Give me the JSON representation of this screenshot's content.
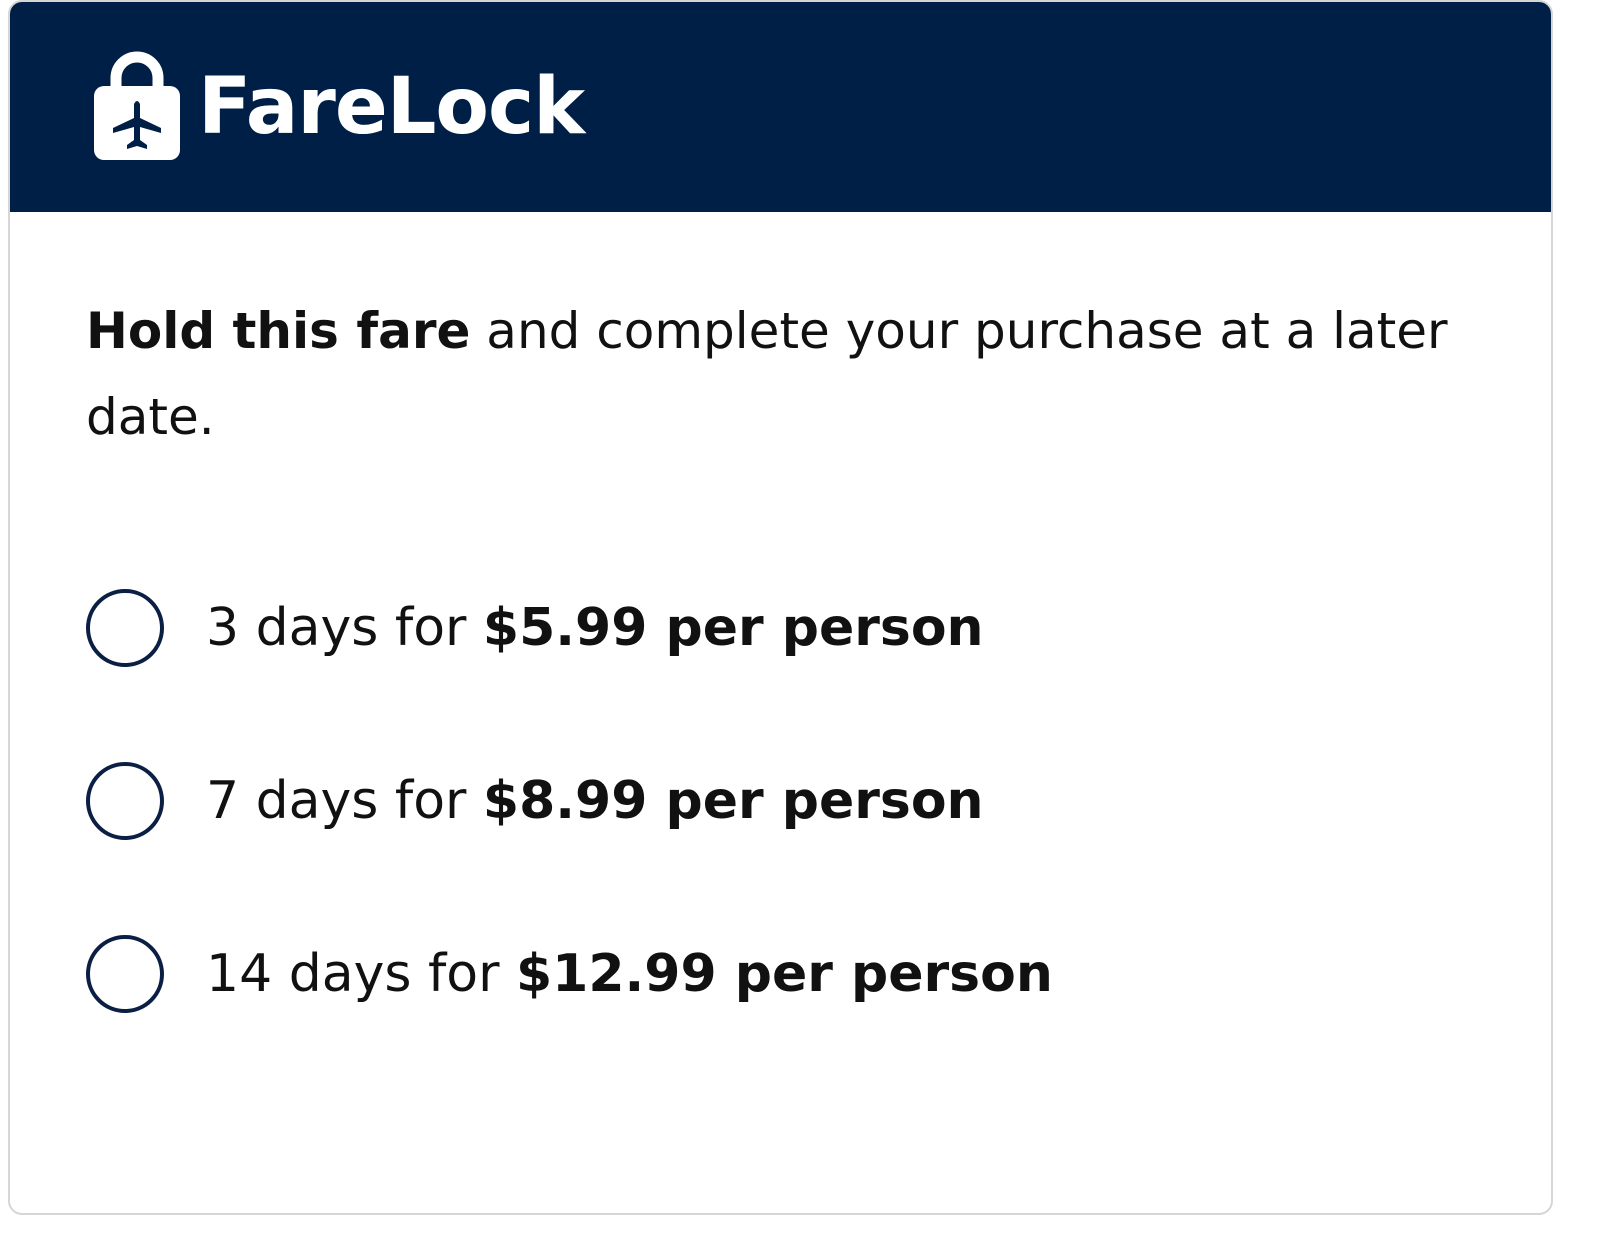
{
  "header": {
    "title": "FareLock",
    "icon": "lock-plane-icon",
    "background_color": "#001f47"
  },
  "description": {
    "bold": "Hold this fare",
    "rest": " and complete your purchase at a later date."
  },
  "options": [
    {
      "prefix": "3 days for ",
      "price": "$5.99 per person",
      "selected": false
    },
    {
      "prefix": "7 days for ",
      "price": "$8.99 per person",
      "selected": false
    },
    {
      "prefix": "14 days for ",
      "price": "$12.99 per person",
      "selected": false
    }
  ]
}
